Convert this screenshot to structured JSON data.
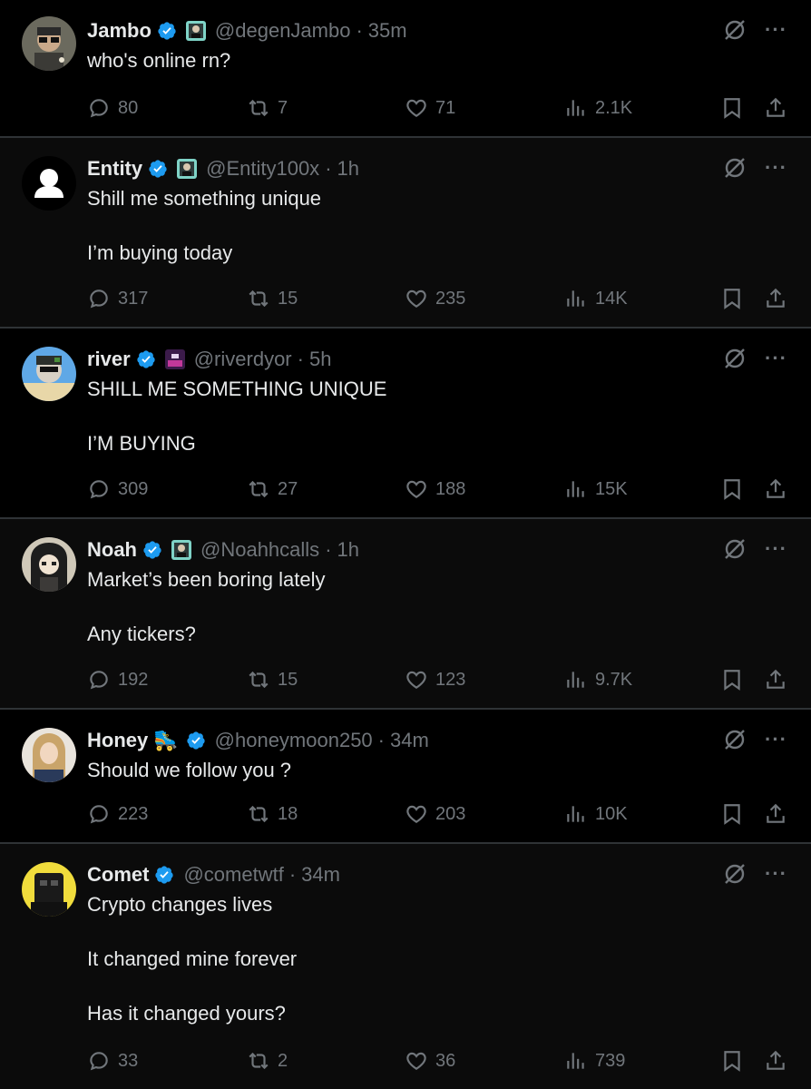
{
  "tweets": [
    {
      "name": "Jambo",
      "handle": "@degenJambo",
      "time": "35m",
      "emoji": "",
      "lines": [
        "who's online rn?"
      ],
      "replies": "80",
      "reposts": "7",
      "likes": "71",
      "views": "2.1K"
    },
    {
      "name": "Entity",
      "handle": "@Entity100x",
      "time": "1h",
      "emoji": "",
      "lines": [
        "Shill me something unique",
        "",
        "I’m buying today"
      ],
      "replies": "317",
      "reposts": "15",
      "likes": "235",
      "views": "14K"
    },
    {
      "name": "river",
      "handle": "@riverdyor",
      "time": "5h",
      "emoji": "",
      "lines": [
        "SHILL ME SOMETHING UNIQUE",
        "",
        "I’M BUYING"
      ],
      "replies": "309",
      "reposts": "27",
      "likes": "188",
      "views": "15K"
    },
    {
      "name": "Noah",
      "handle": "@Noahhcalls",
      "time": "1h",
      "emoji": "",
      "lines": [
        "Market’s been boring lately",
        "",
        "Any tickers?"
      ],
      "replies": "192",
      "reposts": "15",
      "likes": "123",
      "views": "9.7K"
    },
    {
      "name": "Honey",
      "handle": "@honeymoon250",
      "time": "34m",
      "emoji": "🛼",
      "lines": [
        "Should we follow you ?"
      ],
      "replies": "223",
      "reposts": "18",
      "likes": "203",
      "views": "10K"
    },
    {
      "name": "Comet",
      "handle": "@cometwtf",
      "time": "34m",
      "emoji": "",
      "lines": [
        "Crypto changes lives",
        "",
        "It changed mine forever",
        "",
        "Has it changed yours?"
      ],
      "replies": "33",
      "reposts": "2",
      "likes": "36",
      "views": "739"
    }
  ],
  "separator": "·",
  "more_label": "···",
  "colors": {
    "background": "#000000",
    "text": "#e7e9ea",
    "muted": "#71767b",
    "verified": "#1d9bf0",
    "border": "#2f3336"
  }
}
